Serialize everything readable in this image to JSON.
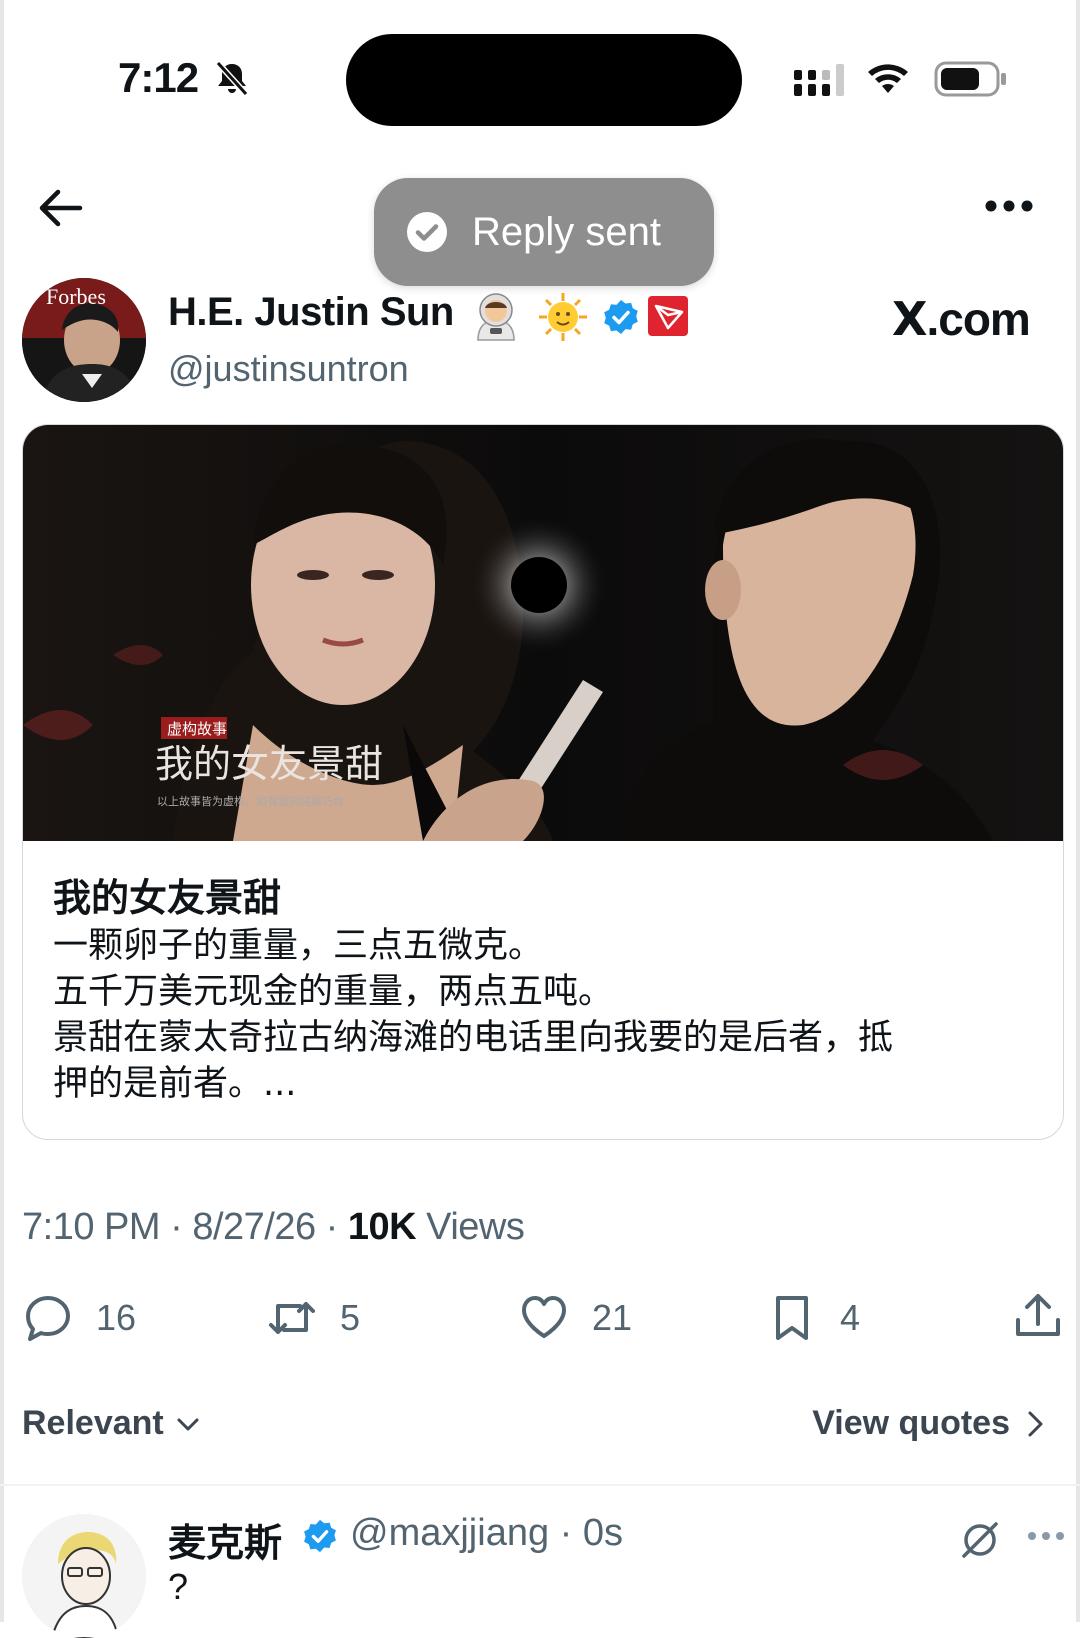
{
  "status_bar": {
    "time": "7:12"
  },
  "toast": {
    "text": "Reply sent"
  },
  "author": {
    "display_name": "H.E. Justin Sun",
    "handle": "@justinsuntron",
    "avatar_text": "Forbes"
  },
  "watermark": {
    "x": "X",
    "suffix": ".com"
  },
  "card": {
    "title": "我的女友景甜",
    "body_lines": [
      "一颗卵子的重量，三点五微克。",
      "五千万美元现金的重量，两点五吨。",
      "景甜在蒙太奇拉古纳海滩的电话里向我要的是后者，抵",
      "押的是前者。..."
    ],
    "image": {
      "tag": "虚构故事",
      "title": "我的女友景甜",
      "disclaimer": "以上故事皆为虚构，如有雷同纯属巧合"
    }
  },
  "meta": {
    "time": "7:10 PM",
    "date": "8/27/26",
    "views_count": "10K",
    "views_label": "Views",
    "sep": " · "
  },
  "actions": {
    "replies": "16",
    "reposts": "5",
    "likes": "21",
    "bookmarks": "4"
  },
  "sort": {
    "label": "Relevant",
    "quotes_label": "View quotes"
  },
  "reply": {
    "name": "麦克斯",
    "handle": "@maxjjiang",
    "time": "0s",
    "text": "?"
  },
  "colors": {
    "verified": "#1d9bf0",
    "tron": "#e0242f",
    "muted": "#536471",
    "toast_bg": "#8e8e8e"
  }
}
